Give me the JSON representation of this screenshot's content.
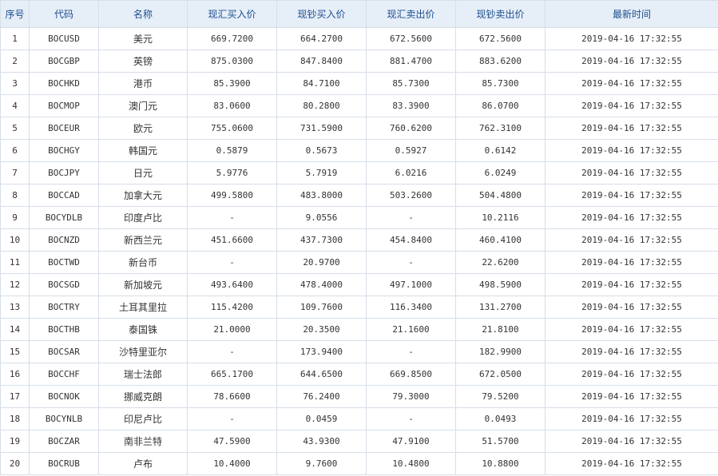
{
  "columns": [
    "序号",
    "代码",
    "名称",
    "现汇买入价",
    "现钞买入价",
    "现汇卖出价",
    "现钞卖出价",
    "最新时间"
  ],
  "rows": [
    {
      "seq": "1",
      "code": "BOCUSD",
      "name": "美元",
      "spot_buy": "669.7200",
      "cash_buy": "664.2700",
      "spot_sell": "672.5600",
      "cash_sell": "672.5600",
      "time": "2019-04-16 17:32:55"
    },
    {
      "seq": "2",
      "code": "BOCGBP",
      "name": "英镑",
      "spot_buy": "875.0300",
      "cash_buy": "847.8400",
      "spot_sell": "881.4700",
      "cash_sell": "883.6200",
      "time": "2019-04-16 17:32:55"
    },
    {
      "seq": "3",
      "code": "BOCHKD",
      "name": "港币",
      "spot_buy": "85.3900",
      "cash_buy": "84.7100",
      "spot_sell": "85.7300",
      "cash_sell": "85.7300",
      "time": "2019-04-16 17:32:55"
    },
    {
      "seq": "4",
      "code": "BOCMOP",
      "name": "澳门元",
      "spot_buy": "83.0600",
      "cash_buy": "80.2800",
      "spot_sell": "83.3900",
      "cash_sell": "86.0700",
      "time": "2019-04-16 17:32:55"
    },
    {
      "seq": "5",
      "code": "BOCEUR",
      "name": "欧元",
      "spot_buy": "755.0600",
      "cash_buy": "731.5900",
      "spot_sell": "760.6200",
      "cash_sell": "762.3100",
      "time": "2019-04-16 17:32:55"
    },
    {
      "seq": "6",
      "code": "BOCHGY",
      "name": "韩国元",
      "spot_buy": "0.5879",
      "cash_buy": "0.5673",
      "spot_sell": "0.5927",
      "cash_sell": "0.6142",
      "time": "2019-04-16 17:32:55"
    },
    {
      "seq": "7",
      "code": "BOCJPY",
      "name": "日元",
      "spot_buy": "5.9776",
      "cash_buy": "5.7919",
      "spot_sell": "6.0216",
      "cash_sell": "6.0249",
      "time": "2019-04-16 17:32:55"
    },
    {
      "seq": "8",
      "code": "BOCCAD",
      "name": "加拿大元",
      "spot_buy": "499.5800",
      "cash_buy": "483.8000",
      "spot_sell": "503.2600",
      "cash_sell": "504.4800",
      "time": "2019-04-16 17:32:55"
    },
    {
      "seq": "9",
      "code": "BOCYDLB",
      "name": "印度卢比",
      "spot_buy": "-",
      "cash_buy": "9.0556",
      "spot_sell": "-",
      "cash_sell": "10.2116",
      "time": "2019-04-16 17:32:55"
    },
    {
      "seq": "10",
      "code": "BOCNZD",
      "name": "新西兰元",
      "spot_buy": "451.6600",
      "cash_buy": "437.7300",
      "spot_sell": "454.8400",
      "cash_sell": "460.4100",
      "time": "2019-04-16 17:32:55"
    },
    {
      "seq": "11",
      "code": "BOCTWD",
      "name": "新台币",
      "spot_buy": "-",
      "cash_buy": "20.9700",
      "spot_sell": "-",
      "cash_sell": "22.6200",
      "time": "2019-04-16 17:32:55"
    },
    {
      "seq": "12",
      "code": "BOCSGD",
      "name": "新加坡元",
      "spot_buy": "493.6400",
      "cash_buy": "478.4000",
      "spot_sell": "497.1000",
      "cash_sell": "498.5900",
      "time": "2019-04-16 17:32:55"
    },
    {
      "seq": "13",
      "code": "BOCTRY",
      "name": "土耳其里拉",
      "spot_buy": "115.4200",
      "cash_buy": "109.7600",
      "spot_sell": "116.3400",
      "cash_sell": "131.2700",
      "time": "2019-04-16 17:32:55"
    },
    {
      "seq": "14",
      "code": "BOCTHB",
      "name": "泰国铢",
      "spot_buy": "21.0000",
      "cash_buy": "20.3500",
      "spot_sell": "21.1600",
      "cash_sell": "21.8100",
      "time": "2019-04-16 17:32:55"
    },
    {
      "seq": "15",
      "code": "BOCSAR",
      "name": "沙特里亚尔",
      "spot_buy": "-",
      "cash_buy": "173.9400",
      "spot_sell": "-",
      "cash_sell": "182.9900",
      "time": "2019-04-16 17:32:55"
    },
    {
      "seq": "16",
      "code": "BOCCHF",
      "name": "瑞士法郎",
      "spot_buy": "665.1700",
      "cash_buy": "644.6500",
      "spot_sell": "669.8500",
      "cash_sell": "672.0500",
      "time": "2019-04-16 17:32:55"
    },
    {
      "seq": "17",
      "code": "BOCNOK",
      "name": "挪威克朗",
      "spot_buy": "78.6600",
      "cash_buy": "76.2400",
      "spot_sell": "79.3000",
      "cash_sell": "79.5200",
      "time": "2019-04-16 17:32:55"
    },
    {
      "seq": "18",
      "code": "BOCYNLB",
      "name": "印尼卢比",
      "spot_buy": "-",
      "cash_buy": "0.0459",
      "spot_sell": "-",
      "cash_sell": "0.0493",
      "time": "2019-04-16 17:32:55"
    },
    {
      "seq": "19",
      "code": "BOCZAR",
      "name": "南非兰特",
      "spot_buy": "47.5900",
      "cash_buy": "43.9300",
      "spot_sell": "47.9100",
      "cash_sell": "51.5700",
      "time": "2019-04-16 17:32:55"
    },
    {
      "seq": "20",
      "code": "BOCRUB",
      "name": "卢布",
      "spot_buy": "10.4000",
      "cash_buy": "9.7600",
      "spot_sell": "10.4800",
      "cash_sell": "10.8800",
      "time": "2019-04-16 17:32:55"
    }
  ],
  "colors": {
    "header_bg": "#e6eef8",
    "header_text": "#1d4e8f",
    "border": "#d6dee8"
  }
}
